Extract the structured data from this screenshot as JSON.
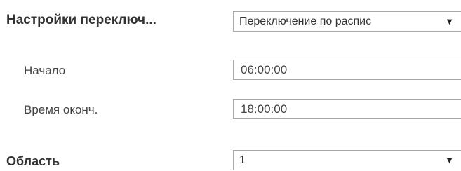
{
  "switch_settings": {
    "label": "Настройки переключ...",
    "selected": "Переключение по распис"
  },
  "start": {
    "label": "Начало",
    "value": "06:00:00"
  },
  "end": {
    "label": "Время оконч.",
    "value": "18:00:00"
  },
  "area": {
    "label": "Область",
    "selected": "1"
  },
  "icons": {
    "dropdown_arrow": "▼"
  }
}
